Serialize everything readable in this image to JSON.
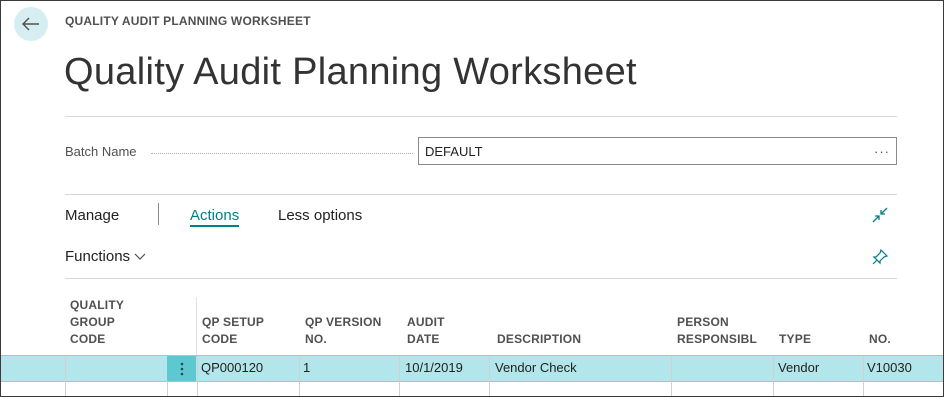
{
  "breadcrumb": "QUALITY AUDIT PLANNING WORKSHEET",
  "title": "Quality Audit Planning Worksheet",
  "batch": {
    "label": "Batch Name",
    "value": "DEFAULT",
    "lookup": "···"
  },
  "actionbar": {
    "manage": "Manage",
    "actions": "Actions",
    "less_options": "Less options",
    "functions": "Functions"
  },
  "columns": {
    "quality_group_code": [
      "QUALITY",
      "GROUP",
      "CODE"
    ],
    "qp_setup_code": [
      "QP SETUP",
      "CODE"
    ],
    "qp_version_no": [
      "QP VERSION",
      "NO."
    ],
    "audit_date": [
      "AUDIT",
      "DATE"
    ],
    "description": "DESCRIPTION",
    "person_responsible": [
      "PERSON",
      "RESPONSIBL"
    ],
    "type": "TYPE",
    "no": "NO."
  },
  "rows": [
    {
      "quality_group_code": "",
      "qp_setup_code": "QP000120",
      "qp_version_no": "1",
      "audit_date": "10/1/2019",
      "description": "Vendor Check",
      "person_responsible": "",
      "type": "Vendor",
      "no": "V10030"
    }
  ],
  "colors": {
    "accent": "#00808a",
    "row_selected": "#b3e6ea",
    "row_menu": "#5ec8d0",
    "back_button": "#d6eef1"
  }
}
